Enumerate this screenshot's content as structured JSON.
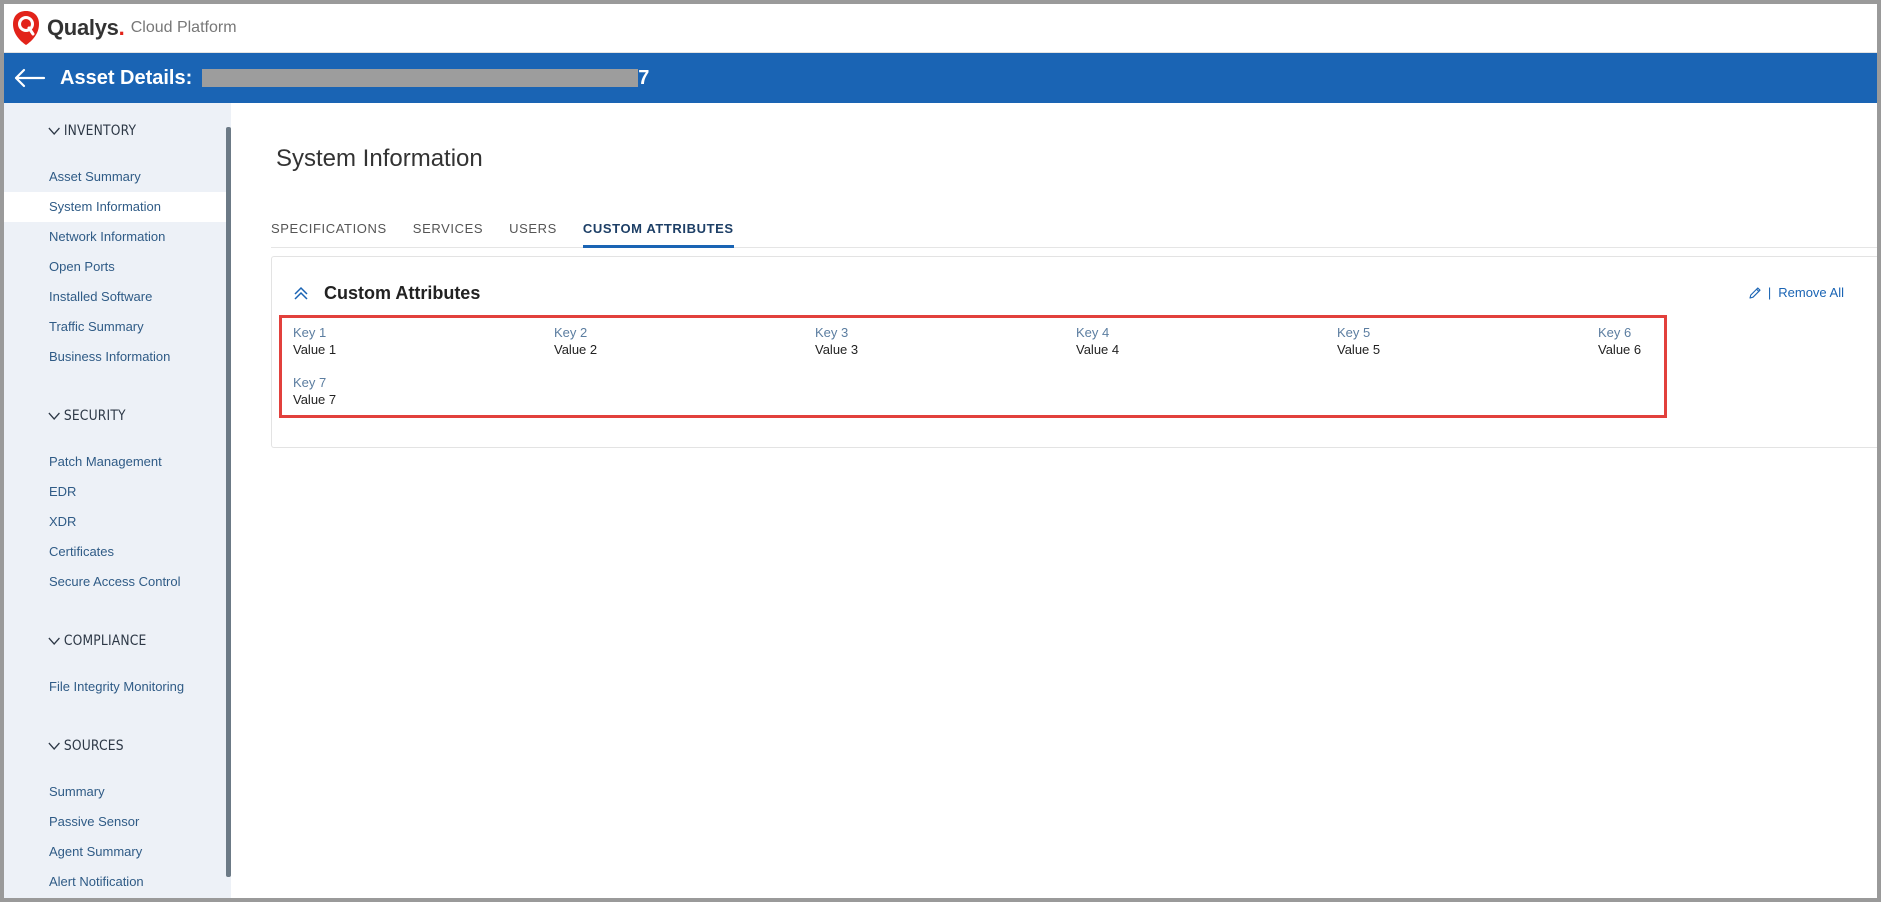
{
  "brand": {
    "name": "Qualys",
    "dot": ".",
    "sub": "Cloud Platform"
  },
  "header": {
    "title": "Asset Details:",
    "asset_suffix": "7"
  },
  "sidebar": {
    "sections": [
      {
        "title": "INVENTORY",
        "items": [
          "Asset Summary",
          "System Information",
          "Network Information",
          "Open Ports",
          "Installed Software",
          "Traffic Summary",
          "Business Information"
        ]
      },
      {
        "title": "SECURITY",
        "items": [
          "Patch Management",
          "EDR",
          "XDR",
          "Certificates",
          "Secure Access Control"
        ]
      },
      {
        "title": "COMPLIANCE",
        "items": [
          "File Integrity Monitoring"
        ]
      },
      {
        "title": "SOURCES",
        "items": [
          "Summary",
          "Passive Sensor",
          "Agent Summary",
          "Alert Notification"
        ]
      }
    ],
    "active_item": "System Information"
  },
  "main": {
    "page_title": "System Information",
    "tabs": [
      "SPECIFICATIONS",
      "SERVICES",
      "USERS",
      "CUSTOM ATTRIBUTES"
    ],
    "active_tab": "CUSTOM ATTRIBUTES",
    "panel": {
      "title": "Custom Attributes",
      "separator": "|",
      "remove_all": "Remove All",
      "attributes": [
        {
          "key": "Key 1",
          "value": "Value 1"
        },
        {
          "key": "Key 2",
          "value": "Value 2"
        },
        {
          "key": "Key 3",
          "value": "Value 3"
        },
        {
          "key": "Key 4",
          "value": "Value 4"
        },
        {
          "key": "Key 5",
          "value": "Value 5"
        },
        {
          "key": "Key 6",
          "value": "Value 6"
        },
        {
          "key": "Key 7",
          "value": "Value 7"
        }
      ]
    }
  },
  "colors": {
    "header_blue": "#1a64b4",
    "sidebar_bg": "#edf1f7",
    "highlight_red": "#e2403c",
    "logo_red": "#e2231a"
  }
}
